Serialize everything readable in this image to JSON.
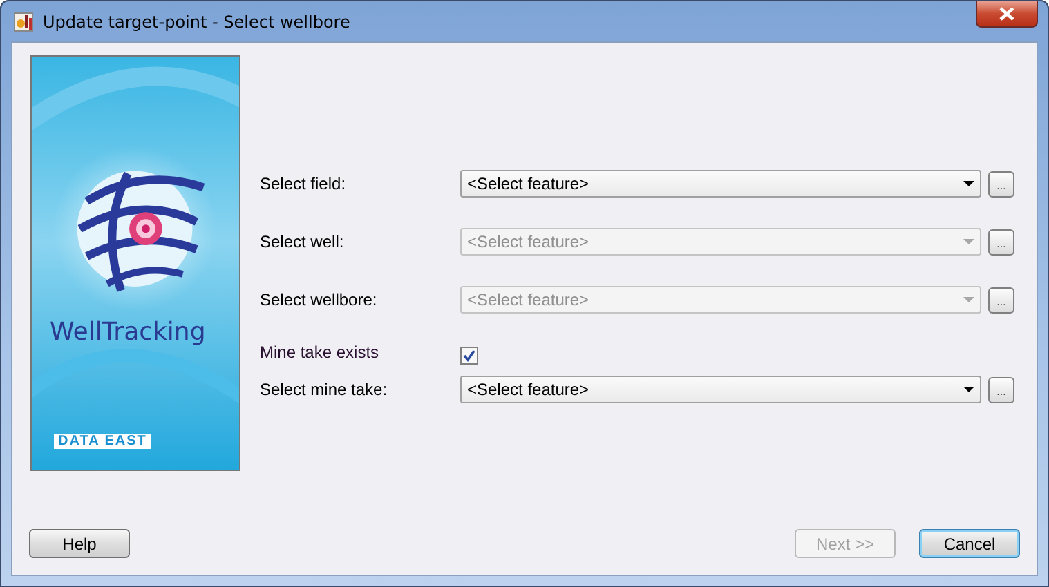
{
  "window": {
    "title": "Update target-point - Select wellbore"
  },
  "banner": {
    "product": "WellTracking",
    "brand": "DATA EAST"
  },
  "form": [
    {
      "kind": "combo",
      "label": "Select field:",
      "value": "<Select feature>",
      "disabled": false,
      "browse": "..."
    },
    {
      "kind": "combo",
      "label": "Select well:",
      "value": "<Select feature>",
      "disabled": true,
      "browse": "..."
    },
    {
      "kind": "combo",
      "label": "Select wellbore:",
      "value": "<Select feature>",
      "disabled": true,
      "browse": "..."
    },
    {
      "kind": "checkbox",
      "label": "Mine take exists",
      "checked": true
    },
    {
      "kind": "combo",
      "label": "Select mine take:",
      "value": "<Select feature>",
      "disabled": false,
      "browse": "..."
    }
  ],
  "buttons": [
    {
      "label": "Help",
      "disabled": false,
      "default": false
    },
    {
      "label": "Next >>",
      "disabled": true,
      "default": false
    },
    {
      "label": "Cancel",
      "disabled": false,
      "default": true
    }
  ]
}
